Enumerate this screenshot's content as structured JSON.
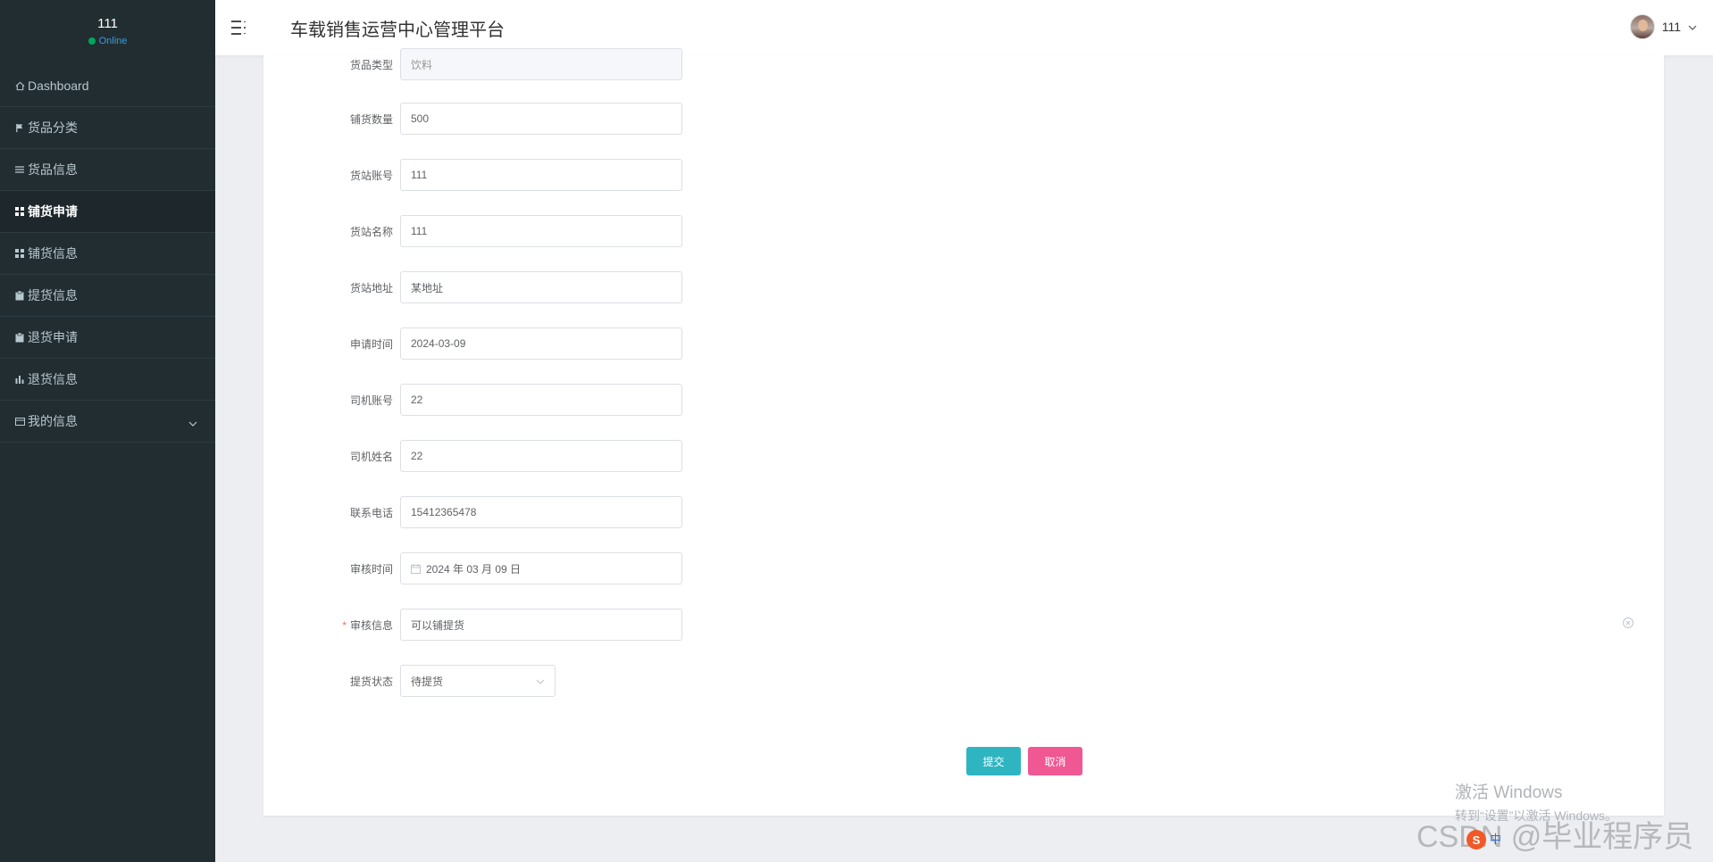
{
  "sidebar": {
    "user_name": "111",
    "status": "Online",
    "items": [
      {
        "label": "Dashboard",
        "icon": "home-icon"
      },
      {
        "label": "货品分类",
        "icon": "flag-icon"
      },
      {
        "label": "货品信息",
        "icon": "list-icon"
      },
      {
        "label": "铺货申请",
        "icon": "grid-icon",
        "active": true
      },
      {
        "label": "铺货信息",
        "icon": "grid-icon"
      },
      {
        "label": "提货信息",
        "icon": "clipboard-icon"
      },
      {
        "label": "退货申请",
        "icon": "clipboard-icon"
      },
      {
        "label": "退货信息",
        "icon": "bar-chart-icon"
      },
      {
        "label": "我的信息",
        "icon": "card-icon",
        "expandable": true
      }
    ]
  },
  "header": {
    "title": "车载销售运营中心管理平台",
    "user_name": "111"
  },
  "form": {
    "fields": [
      {
        "label": "货品类型",
        "value": "饮料",
        "disabled": true
      },
      {
        "label": "铺货数量",
        "value": "500"
      },
      {
        "label": "货站账号",
        "value": "111"
      },
      {
        "label": "货站名称",
        "value": "111"
      },
      {
        "label": "货站地址",
        "value": "某地址"
      },
      {
        "label": "申请时间",
        "value": "2024-03-09"
      },
      {
        "label": "司机账号",
        "value": "22"
      },
      {
        "label": "司机姓名",
        "value": "22"
      },
      {
        "label": "联系电话",
        "value": "15412365478"
      },
      {
        "label": "审核时间",
        "value": "2024 年 03 月 09 日",
        "type": "date"
      },
      {
        "label": "审核信息",
        "value": "可以铺提货",
        "required": true
      },
      {
        "label": "提货状态",
        "value": "待提货",
        "type": "select"
      }
    ],
    "submit_label": "提交",
    "cancel_label": "取消"
  },
  "watermarks": {
    "windows_title": "激活 Windows",
    "windows_sub": "转到“设置”以激活 Windows。",
    "csdn": "CSDN @毕业程序员",
    "tray_ime": "中"
  },
  "colors": {
    "sidebar_bg": "#222d32",
    "submit": "#2fb5c2",
    "cancel": "#ef5893",
    "online": "#00a65a"
  }
}
